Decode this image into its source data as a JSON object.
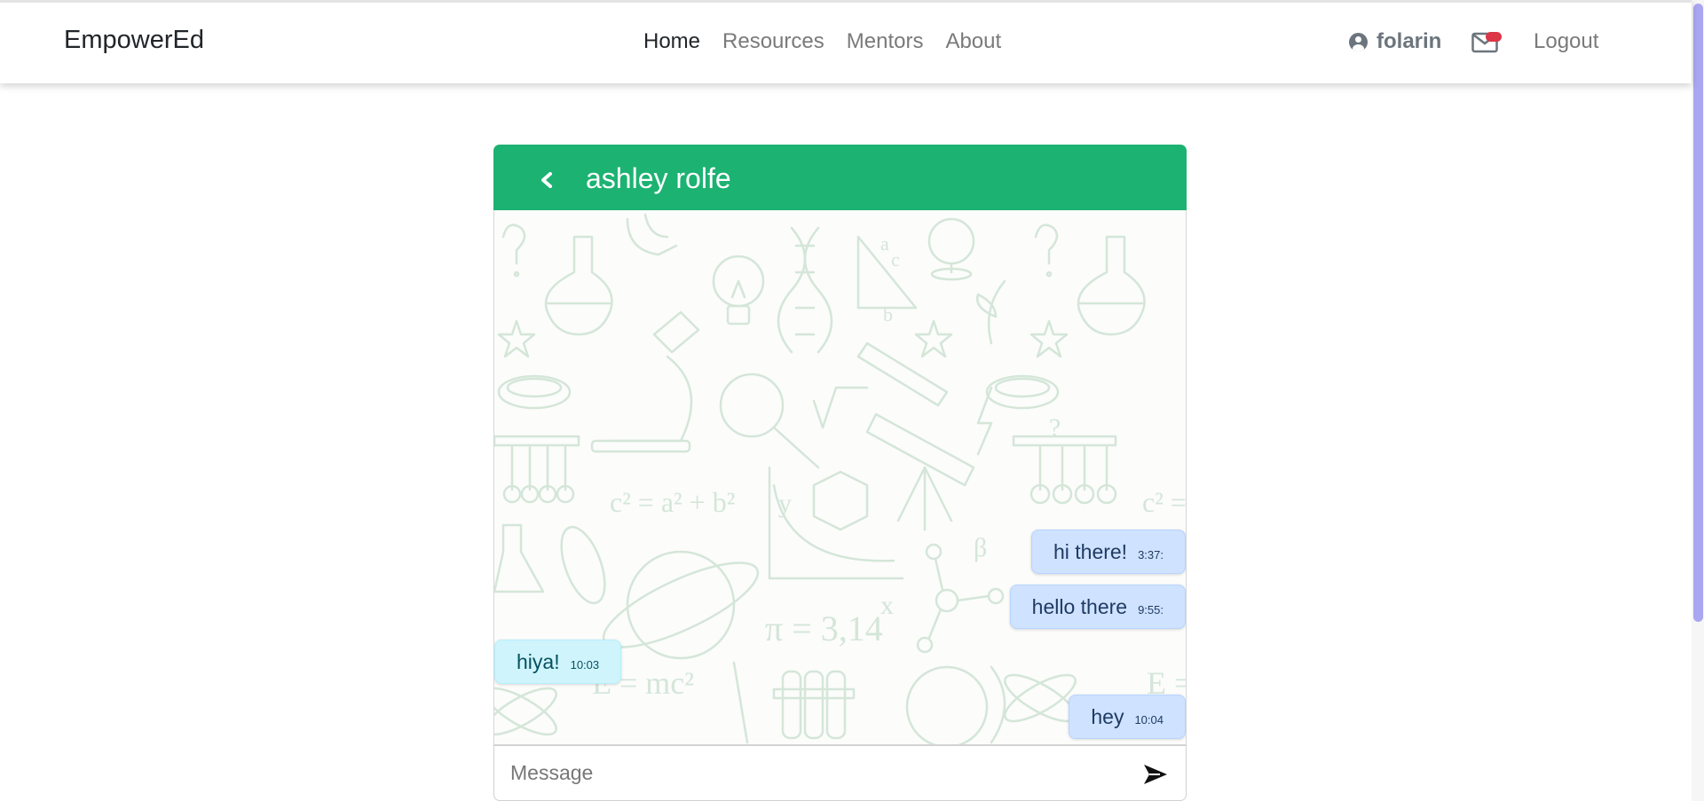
{
  "nav": {
    "brand": "EmpowerEd",
    "links": [
      {
        "label": "Home",
        "active": true
      },
      {
        "label": "Resources",
        "active": false
      },
      {
        "label": "Mentors",
        "active": false
      },
      {
        "label": "About",
        "active": false
      }
    ],
    "user_name": "folarin",
    "logout_label": "Logout",
    "has_unread": true
  },
  "chat": {
    "contact_name": "ashley rolfe",
    "messages": [
      {
        "direction": "out",
        "text": "hi there!",
        "time": "3:37:"
      },
      {
        "direction": "out",
        "text": "hello there",
        "time": "9:55:"
      },
      {
        "direction": "in",
        "text": "hiya!",
        "time": "10:03"
      },
      {
        "direction": "out",
        "text": "hey",
        "time": "10:04"
      }
    ],
    "input_placeholder": "Message",
    "input_value": ""
  },
  "colors": {
    "header_green": "#1cb272",
    "outgoing_bubble": "#cfe2ff",
    "incoming_bubble": "#cff4fc",
    "badge_red": "#dc3545",
    "scrollbar": "#a9a6f2"
  },
  "icons": {
    "user": "user-circle-icon",
    "mail": "envelope-icon",
    "back": "chevron-left-icon",
    "send": "send-arrow-icon"
  }
}
